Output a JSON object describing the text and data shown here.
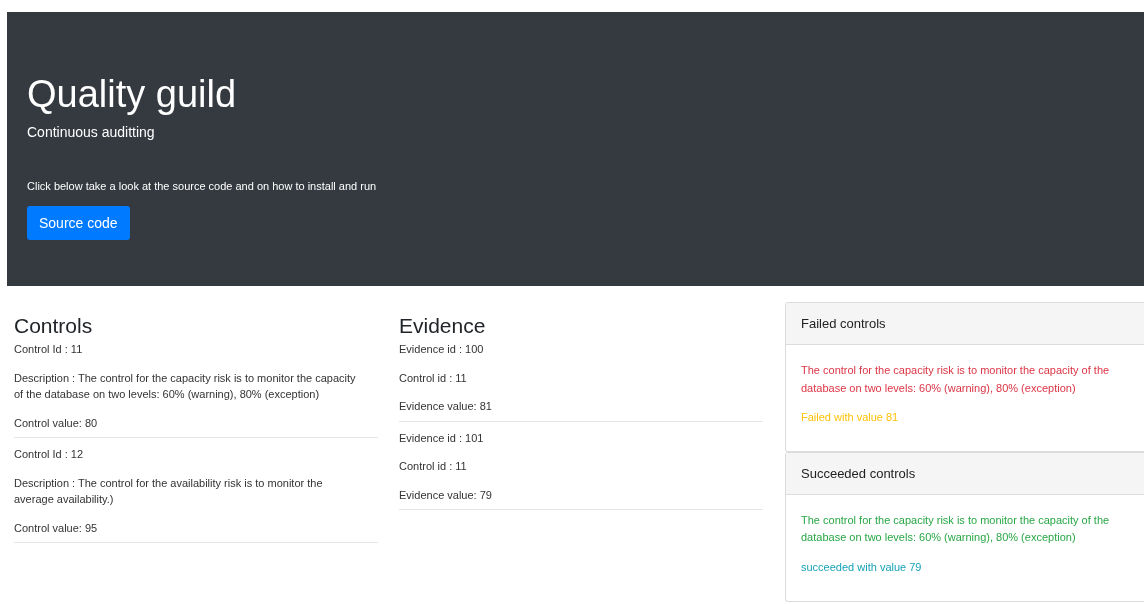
{
  "header": {
    "title": "Quality guild",
    "subtitle": "Continuous auditting",
    "intro": "Click below take a look at the source code and on how to install and run",
    "button": "Source code"
  },
  "controls": {
    "heading": "Controls",
    "items": [
      {
        "id": "Control Id : 11",
        "description": "Description : The control for the capacity risk is to monitor the capacity of the database on two levels: 60% (warning), 80% (exception)",
        "value": "Control value: 80"
      },
      {
        "id": "Control Id : 12",
        "description": "Description : The control for the availability risk is to monitor the average availability.)",
        "value": "Control value: 95"
      }
    ]
  },
  "evidence": {
    "heading": "Evidence",
    "items": [
      {
        "id": "Evidence id : 100",
        "control": "Control id : 11",
        "value": "Evidence value: 81"
      },
      {
        "id": "Evidence id : 101",
        "control": "Control id : 11",
        "value": "Evidence value: 79"
      }
    ]
  },
  "results": [
    {
      "kind": "failed",
      "title": "Failed controls",
      "description": "The control for the capacity risk is to monitor the capacity of the database on two levels: 60% (warning), 80% (exception)",
      "outcome": "Failed with value 81"
    },
    {
      "kind": "succeeded",
      "title": "Succeeded controls",
      "description": "The control for the capacity risk is to monitor the capacity of the database on two levels: 60% (warning), 80% (exception)",
      "outcome": "succeeded with value 79"
    }
  ]
}
